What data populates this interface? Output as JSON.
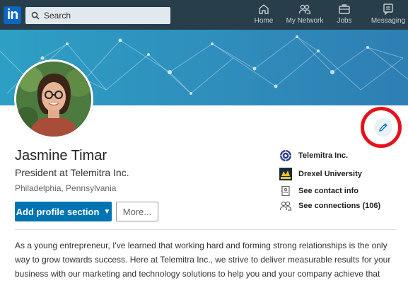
{
  "nav": {
    "logo": "in",
    "search_placeholder": "Search",
    "items": [
      {
        "label": "Home",
        "icon": "home-icon"
      },
      {
        "label": "My Network",
        "icon": "network-icon"
      },
      {
        "label": "Jobs",
        "icon": "briefcase-icon"
      },
      {
        "label": "Messaging",
        "icon": "message-icon"
      }
    ]
  },
  "profile": {
    "name": "Jasmine Timar",
    "headline": "President at Telemitra Inc.",
    "location": "Philadelphia, Pennsylvania",
    "add_section_label": "Add profile section",
    "more_label": "More..."
  },
  "sidebar": {
    "company": "Telemitra Inc.",
    "school": "Drexel University",
    "contact": "See contact info",
    "connections": "See connections (106)"
  },
  "summary": "As a young entrepreneur, I've learned that working hard and forming strong relationships is the only way to grow towards success. Here at Telemitra Inc., we strive to deliver measurable results for your business with our marketing and technology solutions to help you and your company achieve that growth. Whet...",
  "colors": {
    "nav_bg": "#283e4a",
    "brand_blue": "#0073b1",
    "highlight_ring": "#e4131b"
  }
}
